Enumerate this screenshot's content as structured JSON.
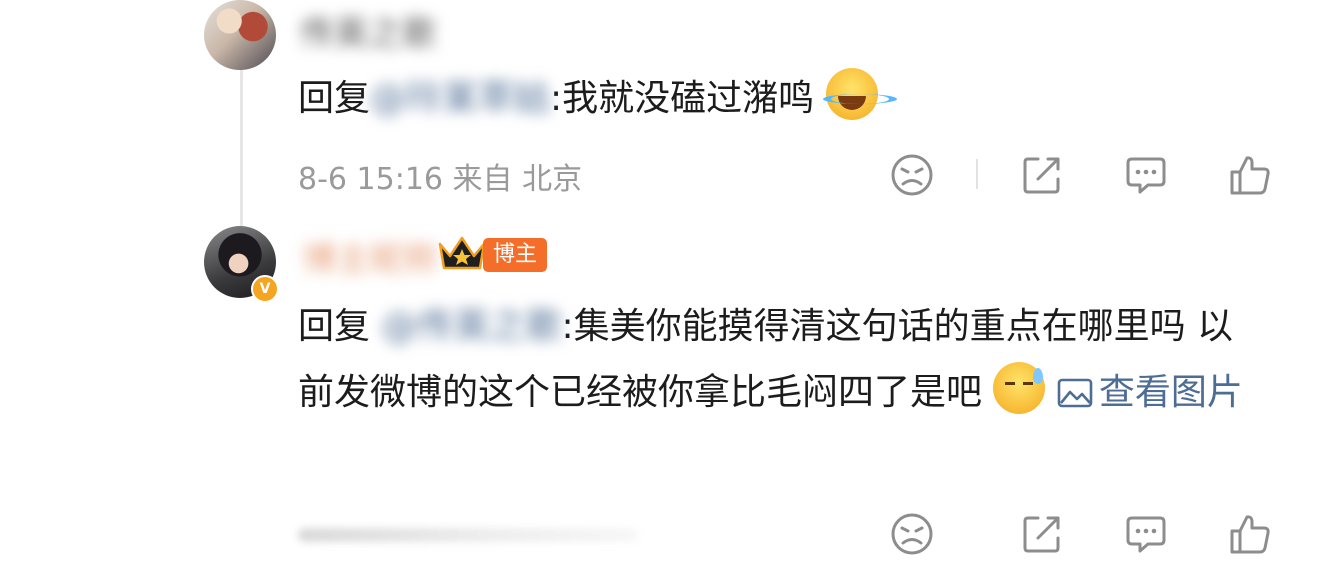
{
  "comments": [
    {
      "user": {
        "name": "传英之歌"
      },
      "reply_prefix": "回复",
      "mention": "@玲某萃姑",
      "text": ":我就没磕过潴鸣",
      "emoji": "laughing-crying-emoji",
      "timestamp": "8-6 15:16",
      "location": "来自 北京"
    },
    {
      "user": {
        "name": "博主昵称",
        "badge": "博主",
        "verified": "V"
      },
      "reply_prefix": "回复",
      "mention": "@传英之歌",
      "text": ":集美你能摸得清这句话的重点在哪里吗 以前发微博的这个已经被你拿比毛闷四了是吧",
      "emoji": "sweat-emoji",
      "view_image_label": "查看图片"
    }
  ],
  "icons": [
    "dislike-icon",
    "share-icon",
    "comment-icon",
    "like-icon"
  ],
  "colors": {
    "mention": "#4e6d95",
    "badge": "#f46e2a",
    "verified": "#f6a521",
    "meta": "#9a9a9a"
  }
}
